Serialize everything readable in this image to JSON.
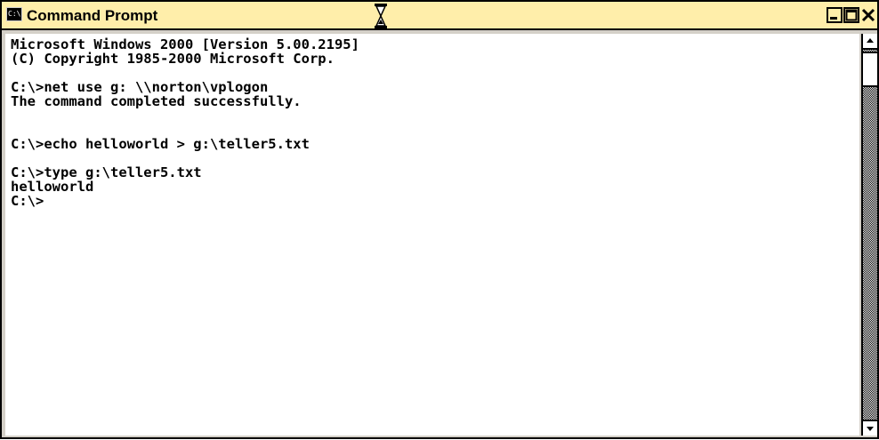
{
  "window": {
    "title": "Command Prompt",
    "icon": "console-icon",
    "icon_text": "C:\\",
    "controls": [
      "minimize-icon",
      "maximize-icon",
      "close-icon"
    ]
  },
  "cursor": {
    "icon": "hourglass-icon"
  },
  "console": {
    "lines": [
      "Microsoft Windows 2000 [Version 5.00.2195]",
      "(C) Copyright 1985-2000 Microsoft Corp.",
      "",
      "C:\\>net use g: \\\\norton\\vplogon",
      "The command completed successfully.",
      "",
      "",
      "C:\\>echo helloworld > g:\\teller5.txt",
      "",
      "C:\\>type g:\\teller5.txt",
      "helloworld",
      "C:\\>"
    ]
  },
  "colors": {
    "titlebar_bg": "#ffeeaa",
    "console_bg": "#ffffff",
    "console_text": "#000000",
    "frame": "#000000"
  }
}
